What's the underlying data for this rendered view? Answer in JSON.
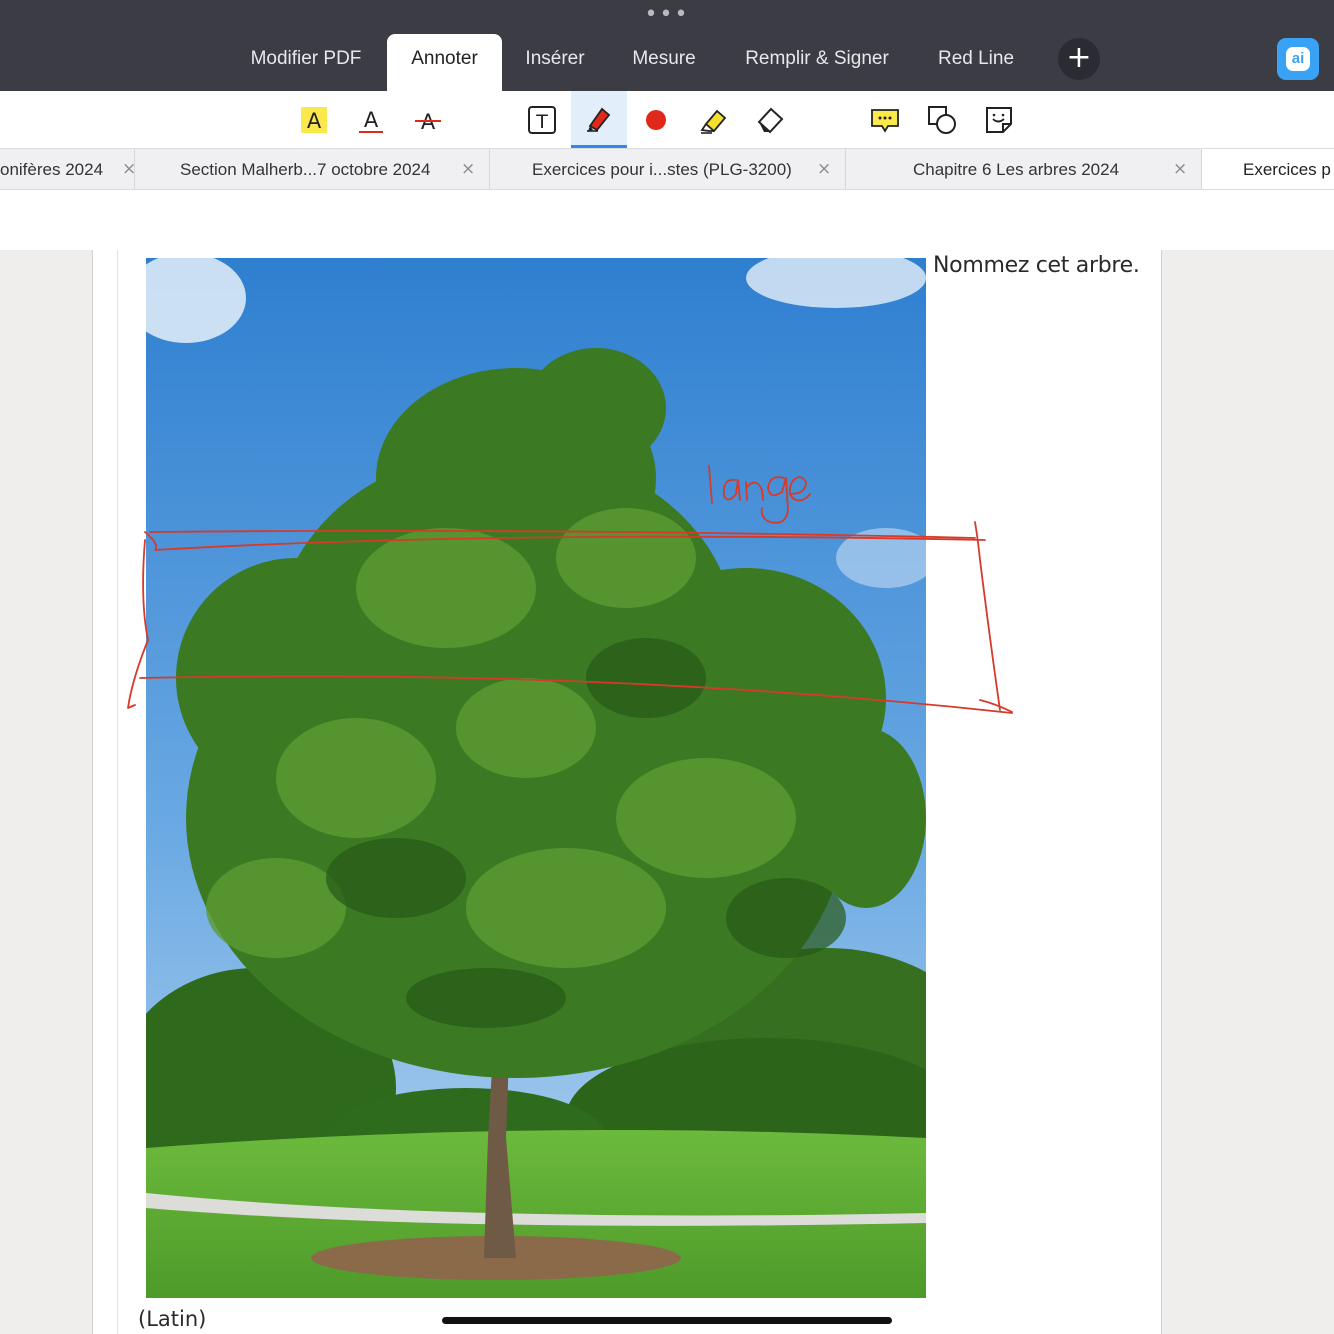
{
  "top_menu": {
    "tabs": [
      {
        "label": "Modifier PDF",
        "active": false
      },
      {
        "label": "Annoter",
        "active": true
      },
      {
        "label": "Insérer",
        "active": false
      },
      {
        "label": "Mesure",
        "active": false
      },
      {
        "label": "Remplir & Signer",
        "active": false
      },
      {
        "label": "Red Line",
        "active": false
      }
    ],
    "add_label": "+",
    "ai_label": "ai"
  },
  "toolbar": {
    "selected_tool": "pen-tool",
    "pen_color": "#e0291a",
    "tools": [
      "highlight-text",
      "underline-text",
      "strikethrough-text",
      "text-box",
      "pen-tool",
      "pen-color",
      "highlighter-tool",
      "eraser-tool",
      "comment",
      "shapes",
      "sticky-note"
    ],
    "icon_letter": "A",
    "textbox_letter": "T"
  },
  "doc_tabs": [
    {
      "label": "onifères 2024",
      "close": "×"
    },
    {
      "label": "Section Malherb...7 octobre 2024",
      "close": "×"
    },
    {
      "label": "Exercices pour i...stes (PLG-3200)",
      "close": "×"
    },
    {
      "label": "Chapitre 6 Les arbres  2024",
      "close": "×"
    },
    {
      "label": "Exercices p",
      "close": ""
    }
  ],
  "document": {
    "question": "Nommez cet arbre.",
    "caption": "(Latin)",
    "handwritten_note": "large",
    "colors": {
      "ink": "#d63a2a",
      "sky": "#4f97d8",
      "foliage": "#3e7a22",
      "grass": "#5fb23a"
    }
  }
}
